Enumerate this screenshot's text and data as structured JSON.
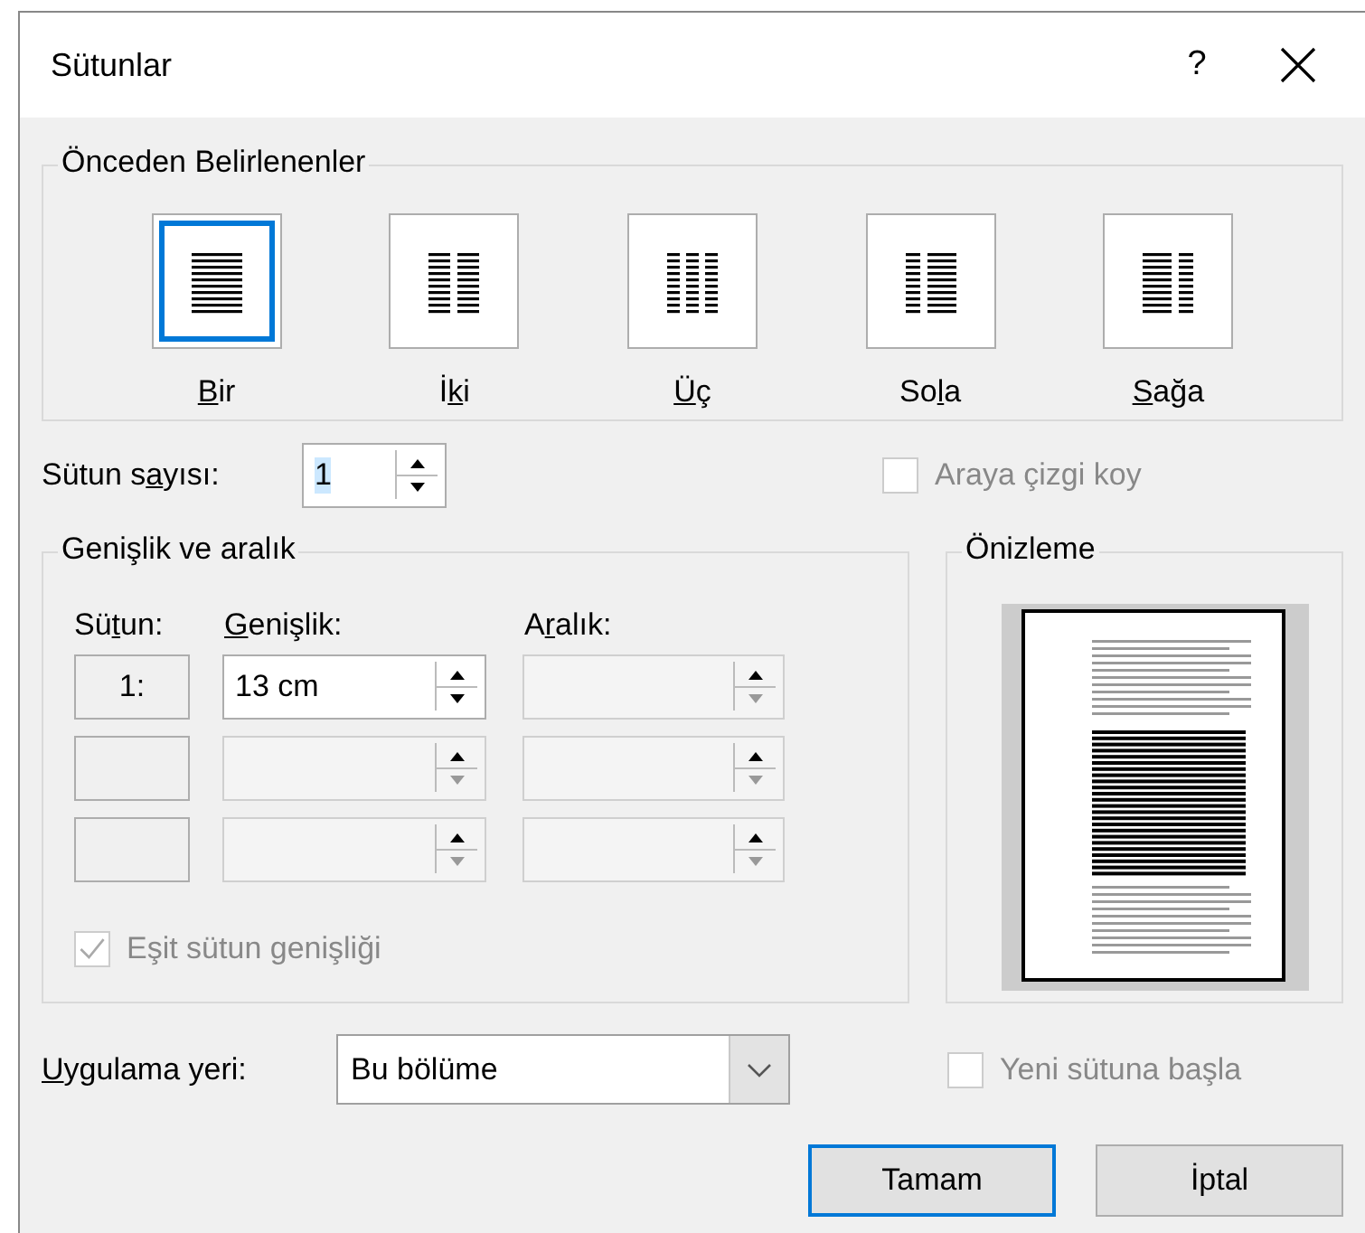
{
  "window": {
    "title": "Sütunlar",
    "help": "?"
  },
  "presets": {
    "title": "Önceden Belirlenenler",
    "items": [
      {
        "kind": "one",
        "label": {
          "key": "B",
          "after": "ir"
        },
        "selected": true
      },
      {
        "kind": "two",
        "label": {
          "before": "İ",
          "key": "k",
          "after": "i"
        },
        "selected": false
      },
      {
        "kind": "three",
        "label": {
          "key": "Ü",
          "after": "ç"
        },
        "selected": false
      },
      {
        "kind": "left",
        "label": {
          "before": "So",
          "key": "l",
          "after": "a"
        },
        "selected": false
      },
      {
        "kind": "right",
        "label": {
          "key": "S",
          "after": "ağa"
        },
        "selected": false
      }
    ]
  },
  "column_count": {
    "label": {
      "before": "Sütun s",
      "key": "a",
      "after": "yısı:"
    },
    "value": "1",
    "value_highlighted": true
  },
  "line_between": {
    "label": "Araya çizgi koy",
    "checked": false,
    "disabled": true
  },
  "width_spacing": {
    "title": "Genişlik ve aralık",
    "headers": [
      {
        "before": "Sü",
        "key": "t",
        "after": "un:"
      },
      {
        "key": "G",
        "after": "enişlik:"
      },
      {
        "before": "A",
        "key": "r",
        "after": "alık:"
      }
    ],
    "rows": [
      {
        "number": "1:",
        "width": "13 cm",
        "enabled": true
      },
      {
        "enabled": false
      },
      {
        "enabled": false
      }
    ],
    "equal_width": {
      "label": "Eşit sütun genişliği",
      "checked": true,
      "disabled": true
    }
  },
  "preview": {
    "title": "Önizleme"
  },
  "apply_to": {
    "label": {
      "key": "U",
      "after": "ygulama yeri:"
    },
    "value": "Bu bölüme"
  },
  "new_column": {
    "label": "Yeni sütuna başla",
    "checked": false,
    "disabled": true
  },
  "buttons": [
    {
      "label": "Tamam",
      "default": true
    },
    {
      "label": "İptal",
      "default": false
    }
  ]
}
